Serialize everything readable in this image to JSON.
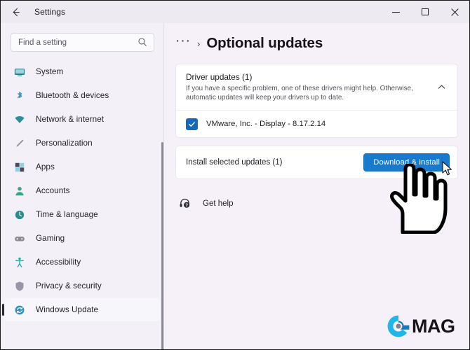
{
  "window": {
    "app_title": "Settings",
    "back_icon": "back-arrow-icon",
    "minimize_label": "–",
    "maximize_label": "□",
    "close_label": "✕"
  },
  "search": {
    "placeholder": "Find a setting",
    "value": "",
    "icon": "search-icon"
  },
  "sidebar": {
    "items": [
      {
        "label": "System",
        "icon": "display-icon",
        "selected": false
      },
      {
        "label": "Bluetooth & devices",
        "icon": "bluetooth-icon",
        "selected": false
      },
      {
        "label": "Network & internet",
        "icon": "wifi-icon",
        "selected": false
      },
      {
        "label": "Personalization",
        "icon": "brush-icon",
        "selected": false
      },
      {
        "label": "Apps",
        "icon": "apps-grid-icon",
        "selected": false
      },
      {
        "label": "Accounts",
        "icon": "person-icon",
        "selected": false
      },
      {
        "label": "Time & language",
        "icon": "clock-icon",
        "selected": false
      },
      {
        "label": "Gaming",
        "icon": "gamepad-icon",
        "selected": false
      },
      {
        "label": "Accessibility",
        "icon": "accessibility-person-icon",
        "selected": false
      },
      {
        "label": "Privacy & security",
        "icon": "shield-icon",
        "selected": false
      },
      {
        "label": "Windows Update",
        "icon": "windows-update-icon",
        "selected": true
      }
    ]
  },
  "main": {
    "breadcrumb_overflow": "···",
    "breadcrumb_separator": "›",
    "page_title": "Optional updates",
    "driver_card": {
      "title": "Driver updates (1)",
      "description": "If you have a specific problem, one of these drivers might help. Otherwise, automatic updates will keep your drivers up to date.",
      "expand_icon": "chevron-up-icon",
      "expanded": true,
      "items": [
        {
          "label": "VMware, Inc. - Display - 8.17.2.14",
          "checked": true
        }
      ]
    },
    "install_card": {
      "label": "Install selected updates (1)",
      "button_label": "Download & install"
    },
    "get_help": {
      "label": "Get help",
      "icon": "help-headset-icon"
    }
  },
  "overlay": {
    "hand_cursor_icon": "pointing-hand-cursor",
    "arrow_cursor_icon": "arrow-cursor",
    "watermark_text": "MAG",
    "watermark_logo_icon": "emag-e-logo"
  },
  "colors": {
    "accent_blue": "#1879cd",
    "checkbox_blue": "#1668bd",
    "window_bg": "#f6f1f8",
    "sidebar_bg": "#f3f0f8",
    "card_bg": "#ffffff",
    "logo_cyan": "#1fb6e8",
    "logo_blue": "#1679c0"
  }
}
